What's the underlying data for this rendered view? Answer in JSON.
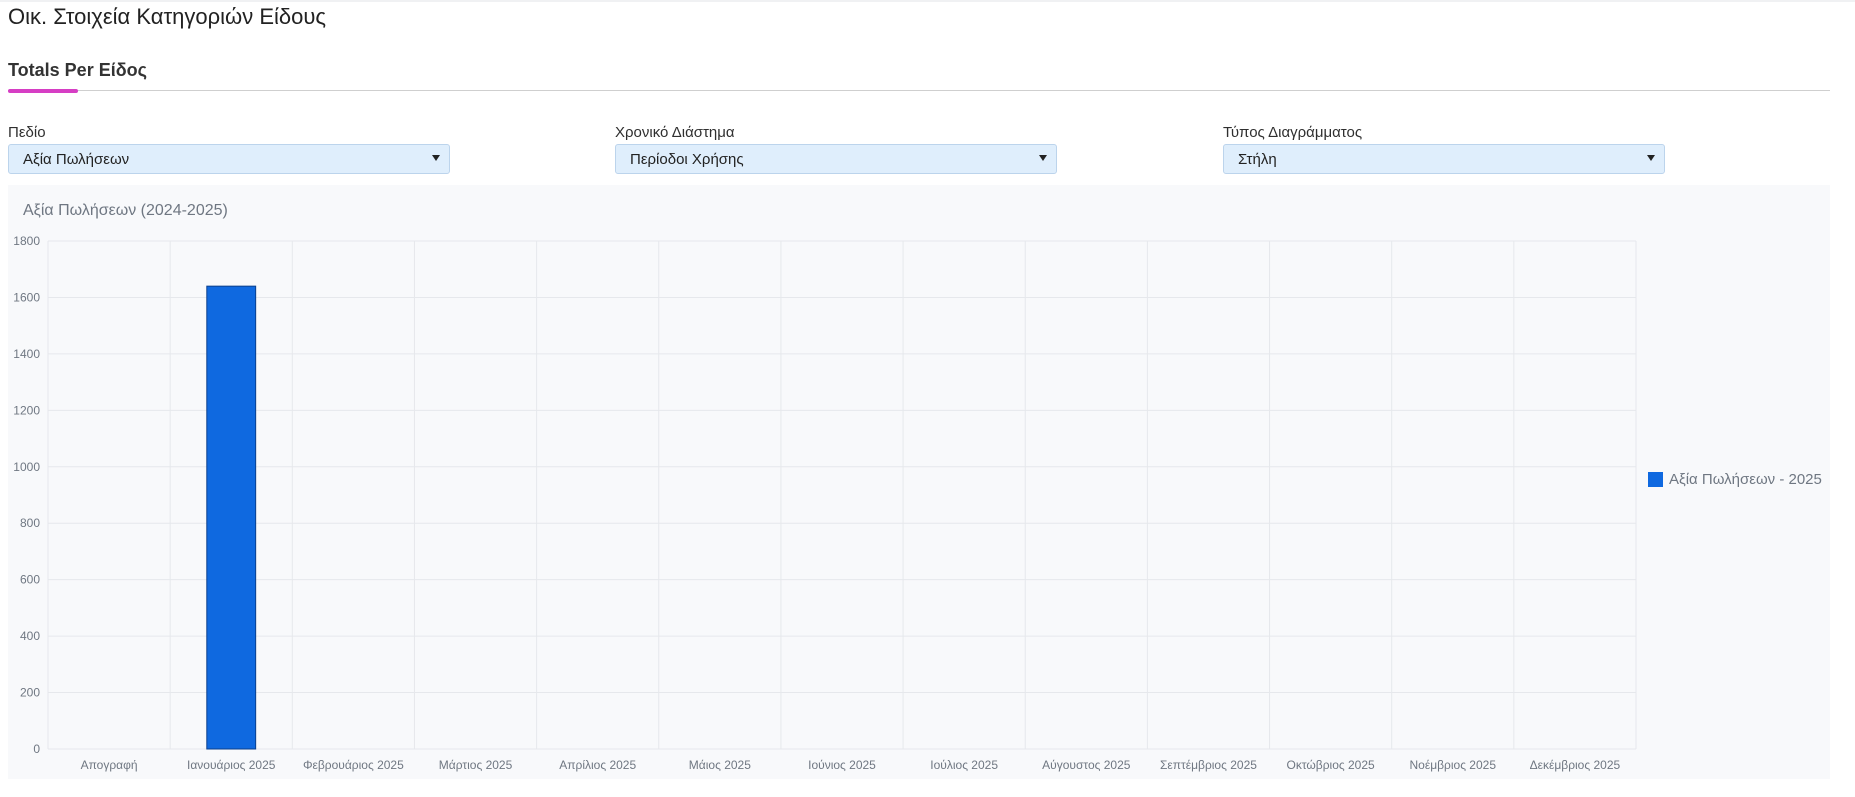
{
  "page": {
    "title": "Οικ. Στοιχεία Κατηγοριών Είδους"
  },
  "tabs": [
    {
      "label": "Totals Per Είδος",
      "active": true
    }
  ],
  "filters": {
    "field": {
      "label": "Πεδίο",
      "value": "Αξία Πωλήσεων"
    },
    "period": {
      "label": "Χρονικό Διάστημα",
      "value": "Περίοδοι Χρήσης"
    },
    "chart_type": {
      "label": "Τύπος Διαγράμματος",
      "value": "Στήλη"
    }
  },
  "colors": {
    "accent": "#d63ec4",
    "series": "#0f69e0",
    "select_bg": "#dfeefc"
  },
  "chart_data": {
    "type": "bar",
    "title": "Αξία Πωλήσεων (2024-2025)",
    "xlabel": "",
    "ylabel": "",
    "ylim": [
      0,
      1800
    ],
    "yticks": [
      0,
      200,
      400,
      600,
      800,
      1000,
      1200,
      1400,
      1600,
      1800
    ],
    "categories": [
      "Απογραφή",
      "Ιανουάριος 2025",
      "Φεβρουάριος 2025",
      "Μάρτιος 2025",
      "Απρίλιος 2025",
      "Μάιος 2025",
      "Ιούνιος 2025",
      "Ιούλιος 2025",
      "Αύγουστος 2025",
      "Σεπτέμβριος 2025",
      "Οκτώβριος 2025",
      "Νοέμβριος 2025",
      "Δεκέμβριος 2025"
    ],
    "series": [
      {
        "name": "Αξία Πωλήσεων - 2025",
        "color": "#0f69e0",
        "values": [
          0,
          1640,
          0,
          0,
          0,
          0,
          0,
          0,
          0,
          0,
          0,
          0,
          0
        ]
      }
    ],
    "grid": true,
    "legend": "right"
  }
}
